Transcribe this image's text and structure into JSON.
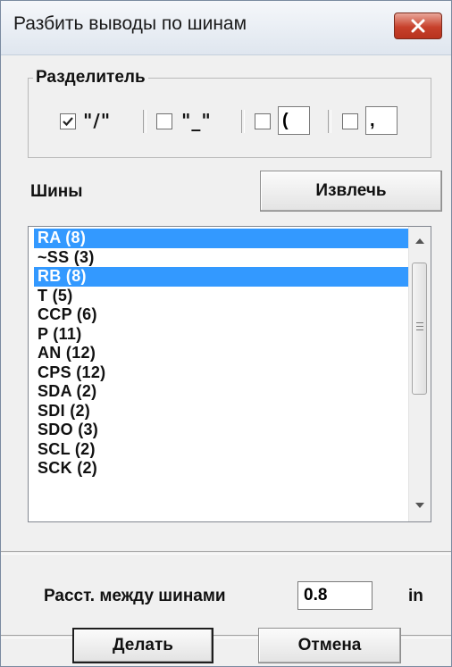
{
  "window": {
    "title": "Разбить выводы по шинам"
  },
  "separator_group": {
    "label": "Разделитель",
    "options": [
      {
        "text": "\"/\"",
        "checked": true
      },
      {
        "text": "\"_\"",
        "checked": false
      },
      {
        "input_value": "(",
        "checked": false
      },
      {
        "input_value": ",",
        "checked": false
      }
    ]
  },
  "buses": {
    "label": "Шины",
    "extract_button": "Извлечь",
    "items": [
      {
        "label": "RA (8)",
        "selected": true
      },
      {
        "label": "~SS (3)",
        "selected": false
      },
      {
        "label": "RB (8)",
        "selected": true
      },
      {
        "label": "T (5)",
        "selected": false
      },
      {
        "label": "CCP (6)",
        "selected": false
      },
      {
        "label": "P (11)",
        "selected": false
      },
      {
        "label": "AN (12)",
        "selected": false
      },
      {
        "label": "CPS (12)",
        "selected": false
      },
      {
        "label": "SDA (2)",
        "selected": false
      },
      {
        "label": "SDI (2)",
        "selected": false
      },
      {
        "label": "SDO (3)",
        "selected": false
      },
      {
        "label": "SCL (2)",
        "selected": false
      },
      {
        "label": "SCK (2)",
        "selected": false
      }
    ]
  },
  "spacing": {
    "label": "Расст. между шинами",
    "value": "0.8",
    "unit": "in"
  },
  "footer": {
    "ok_button": "Делать",
    "cancel_button": "Отмена"
  },
  "colors": {
    "selection": "#3399ff",
    "close_button": "#c7402b"
  }
}
